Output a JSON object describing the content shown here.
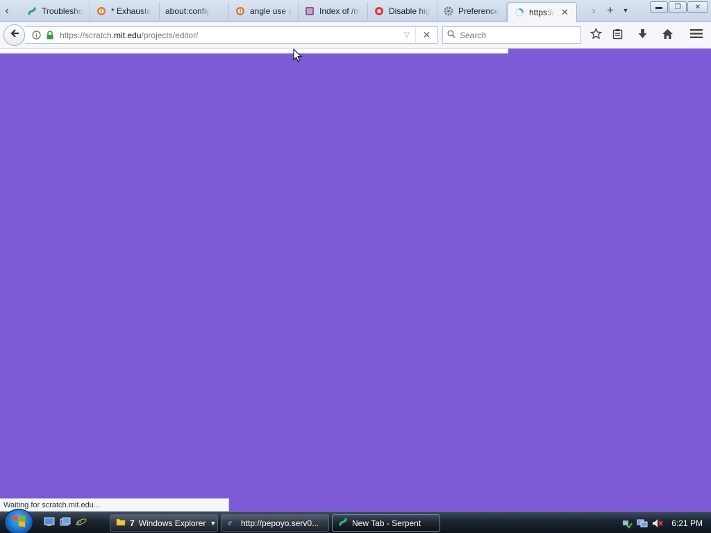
{
  "browser": {
    "tabs": [
      {
        "label": "Troublesho",
        "icon": "serpent-icon"
      },
      {
        "label": "* Exhauste",
        "icon": "alert-icon"
      },
      {
        "label": "about:config",
        "icon": "none"
      },
      {
        "label": "angle use a",
        "icon": "alert-icon"
      },
      {
        "label": "Index of /m",
        "icon": "folder-icon"
      },
      {
        "label": "Disable hig",
        "icon": "globe-icon"
      },
      {
        "label": "Preference",
        "icon": "gear-icon"
      },
      {
        "label": "https://",
        "icon": "loading-icon",
        "active": true
      }
    ],
    "url": {
      "prefix": "https://scratch.",
      "host": "mit.edu",
      "path": "/projects/editor/"
    },
    "search_placeholder": "Search",
    "window_buttons": {
      "minimize": "▬",
      "maximize": "❐",
      "close": "✕"
    }
  },
  "page": {
    "background_color": "#7e5bd6",
    "loading_progress": 0.715
  },
  "status": {
    "text": "Waiting for scratch.mit.edu..."
  },
  "taskbar": {
    "tasks": [
      {
        "label": "Windows Explorer",
        "count": "7",
        "icon": "folder-icon",
        "grouped": true
      },
      {
        "label": "http://pepoyo.serv0...",
        "icon": "ie-icon"
      },
      {
        "label": "New Tab - Serpent",
        "icon": "serpent-icon",
        "active": true
      }
    ],
    "clock": "6:21 PM"
  }
}
